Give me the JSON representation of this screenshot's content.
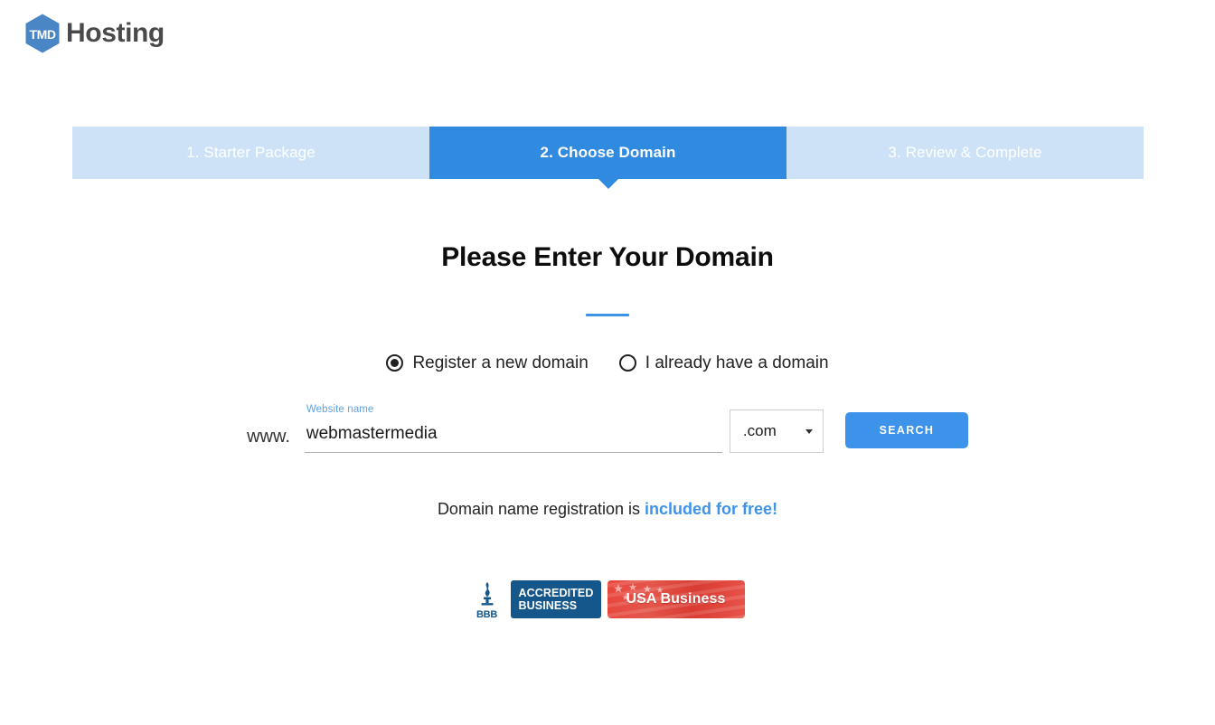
{
  "brand": {
    "mark_text": "TMD",
    "name": "Hosting",
    "mark_color": "#4a86c5",
    "name_color": "#4a4a4a"
  },
  "steps": [
    {
      "label": "1. Starter Package",
      "active": false
    },
    {
      "label": "2. Choose Domain",
      "active": true
    },
    {
      "label": "3. Review & Complete",
      "active": false
    }
  ],
  "main": {
    "title": "Please Enter Your Domain",
    "accent_color": "#3d93ea",
    "radios": [
      {
        "label": "Register a new domain",
        "checked": true
      },
      {
        "label": "I already have a domain",
        "checked": false
      }
    ],
    "form": {
      "www_prefix": "www.",
      "field_label": "Website name",
      "field_value": "webmastermedia",
      "field_placeholder": "Website name",
      "tld_value": ".com",
      "search_label": "SEARCH"
    },
    "free_note_prefix": "Domain name registration is ",
    "free_note_highlight": "included for free!"
  },
  "badges": {
    "bbb_text": "BBB",
    "accredited_line1": "ACCREDITED",
    "accredited_line2": "BUSINESS",
    "usa_label": "USA Business",
    "accredited_color": "#15578a",
    "usa_color": "#e8453c"
  }
}
